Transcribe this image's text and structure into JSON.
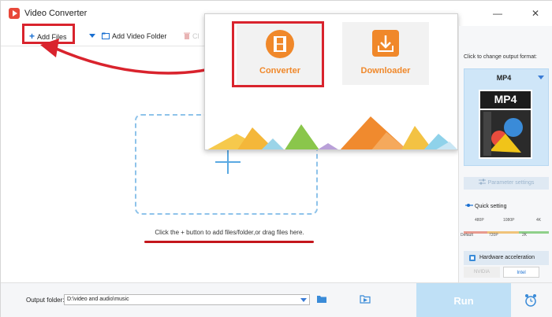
{
  "app": {
    "title": "Video Converter"
  },
  "window_controls": {
    "minimize": "—",
    "close": "✕"
  },
  "toolbar": {
    "add_files": "Add Files",
    "add_video_folder": "Add Video Folder",
    "clear_partial": "Cl"
  },
  "popup": {
    "converter_label": "Converter",
    "downloader_label": "Downloader"
  },
  "main": {
    "hint": "Click the + button to add files/folder,or drag files here."
  },
  "sidebar": {
    "format_prompt": "Click to change output format:",
    "format_name": "MP4",
    "format_badge": "MP4",
    "parameter_settings": "Parameter settings",
    "quick_setting": "Quick setting",
    "top_ticks": [
      "480P",
      "1080P",
      "4K"
    ],
    "bottom_ticks": [
      "Default",
      "720P",
      "2K"
    ],
    "hardware_acceleration": "Hardware acceleration",
    "chip_nvidia": "NVIDIA",
    "chip_intel": "Intel"
  },
  "bottombar": {
    "output_folder_label": "Output folder:",
    "output_folder_value": "D:\\video and audio\\music",
    "run_label": "Run"
  },
  "colors": {
    "accent_blue": "#1a6fd1",
    "highlight_red": "#d9232d",
    "orange": "#f0882a",
    "run_button": "#bfe0f6"
  }
}
